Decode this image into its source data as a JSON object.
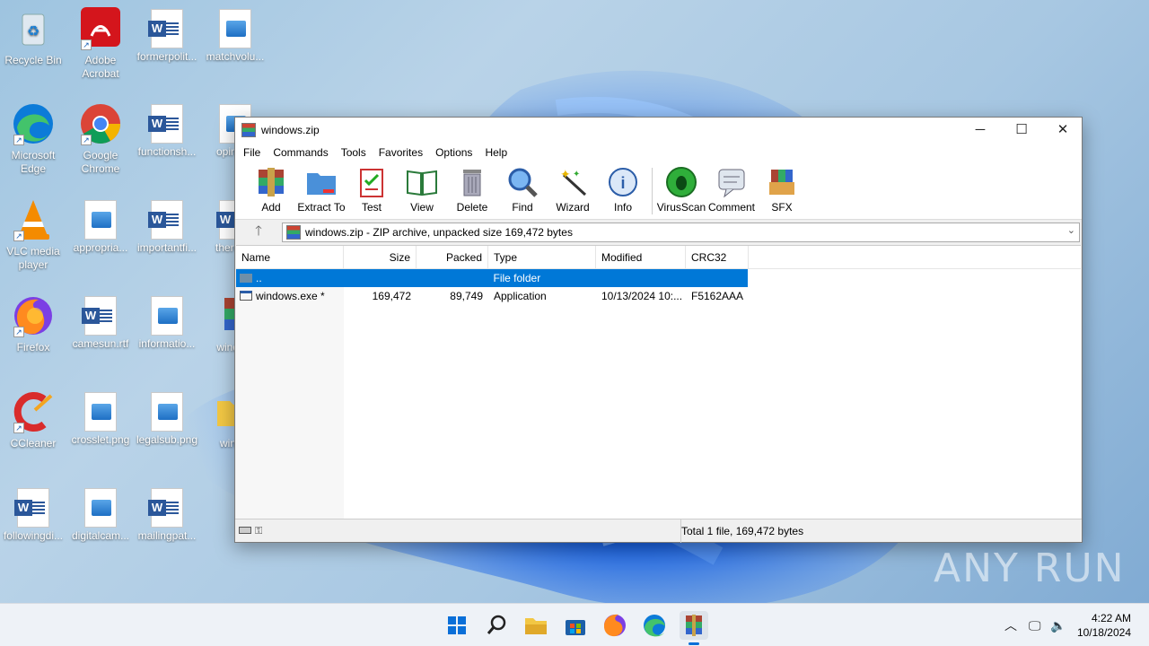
{
  "desktop": {
    "icons": [
      {
        "label": "Recycle Bin",
        "icon": "recycle-bin-icon"
      },
      {
        "label": "Adobe Acrobat",
        "icon": "acrobat-icon"
      },
      {
        "label": "formerpolit...",
        "icon": "word-doc-icon"
      },
      {
        "label": "matchvolu...",
        "icon": "image-file-icon"
      },
      {
        "label": "Microsoft Edge",
        "icon": "edge-icon"
      },
      {
        "label": "Google Chrome",
        "icon": "chrome-icon"
      },
      {
        "label": "functionsh...",
        "icon": "word-doc-icon"
      },
      {
        "label": "opinio...",
        "icon": "image-file-icon"
      },
      {
        "label": "VLC media player",
        "icon": "vlc-icon"
      },
      {
        "label": "appropria...",
        "icon": "image-file-icon"
      },
      {
        "label": "importantfi...",
        "icon": "word-doc-icon"
      },
      {
        "label": "therea...",
        "icon": "word-doc-icon"
      },
      {
        "label": "Firefox",
        "icon": "firefox-icon"
      },
      {
        "label": "camesun.rtf",
        "icon": "word-doc-icon"
      },
      {
        "label": "informatio...",
        "icon": "image-file-icon"
      },
      {
        "label": "windo...",
        "icon": "winrar-archive-icon"
      },
      {
        "label": "CCleaner",
        "icon": "ccleaner-icon"
      },
      {
        "label": "crosslet.png",
        "icon": "image-file-icon"
      },
      {
        "label": "legalsub.png",
        "icon": "image-file-icon"
      },
      {
        "label": "winc...",
        "icon": "folder-icon"
      },
      {
        "label": "followingdi...",
        "icon": "word-doc-icon"
      },
      {
        "label": "digitalcam...",
        "icon": "image-file-icon"
      },
      {
        "label": "mailingpat...",
        "icon": "word-doc-icon"
      }
    ]
  },
  "window": {
    "title": "windows.zip",
    "menu": [
      "File",
      "Commands",
      "Tools",
      "Favorites",
      "Options",
      "Help"
    ],
    "toolbar": [
      {
        "label": "Add",
        "icon": "add-icon"
      },
      {
        "label": "Extract To",
        "icon": "extract-to-icon"
      },
      {
        "label": "Test",
        "icon": "test-icon"
      },
      {
        "label": "View",
        "icon": "view-icon"
      },
      {
        "label": "Delete",
        "icon": "delete-icon"
      },
      {
        "label": "Find",
        "icon": "find-icon"
      },
      {
        "label": "Wizard",
        "icon": "wizard-icon"
      },
      {
        "label": "Info",
        "icon": "info-icon"
      },
      {
        "label": "VirusScan",
        "icon": "virusscan-icon"
      },
      {
        "label": "Comment",
        "icon": "comment-icon"
      },
      {
        "label": "SFX",
        "icon": "sfx-icon"
      }
    ],
    "address": "windows.zip - ZIP archive, unpacked size 169,472 bytes",
    "columns": [
      "Name",
      "Size",
      "Packed",
      "Type",
      "Modified",
      "CRC32"
    ],
    "rows": [
      {
        "name": "..",
        "size": "",
        "packed": "",
        "type": "File folder",
        "modified": "",
        "crc": ""
      },
      {
        "name": "windows.exe *",
        "size": "169,472",
        "packed": "89,749",
        "type": "Application",
        "modified": "10/13/2024 10:...",
        "crc": "F5162AAA"
      }
    ],
    "status": "Total 1 file, 169,472 bytes"
  },
  "taskbar": {
    "apps": [
      "start-icon",
      "search-icon",
      "file-explorer-icon",
      "store-icon",
      "firefox-icon",
      "edge-icon",
      "winrar-icon"
    ],
    "time": "4:22 AM",
    "date": "10/18/2024"
  },
  "watermark": "ANY RUN",
  "colors": {
    "selection": "#0078d7",
    "taskbar": "#eef2f7"
  }
}
